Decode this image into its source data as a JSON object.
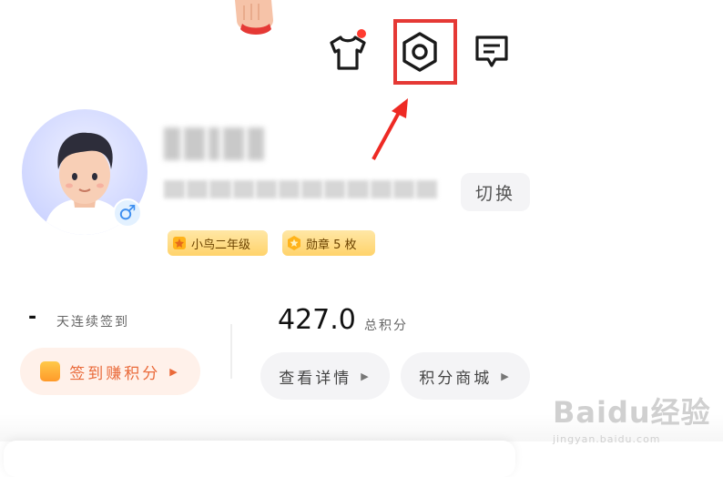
{
  "header": {
    "shirt_icon": "shirt-icon",
    "settings_icon": "hexagon-settings-icon",
    "message_icon": "message-icon",
    "notification_dot_color": "#ff3b30",
    "highlight_color": "#e53935"
  },
  "profile": {
    "switch_label": "切换",
    "gender_symbol": "♂",
    "badges": [
      {
        "label": "小鸟二年级",
        "icon": "star-icon"
      },
      {
        "label": "勋章 5 枚",
        "icon": "medal-icon"
      }
    ]
  },
  "stats": {
    "streak_value": "-",
    "streak_label": "天连续签到",
    "points_value": "427.0",
    "points_label": "总积分"
  },
  "actions": {
    "sign_in_label": "签到赚积分",
    "detail_label": "查看详情",
    "mall_label": "积分商城"
  },
  "watermark": {
    "logo": "Baidu经验",
    "url": "jingyan.baidu.com"
  },
  "colors": {
    "accent_orange": "#ea6a3a",
    "badge_gold": "#ffd36b"
  }
}
